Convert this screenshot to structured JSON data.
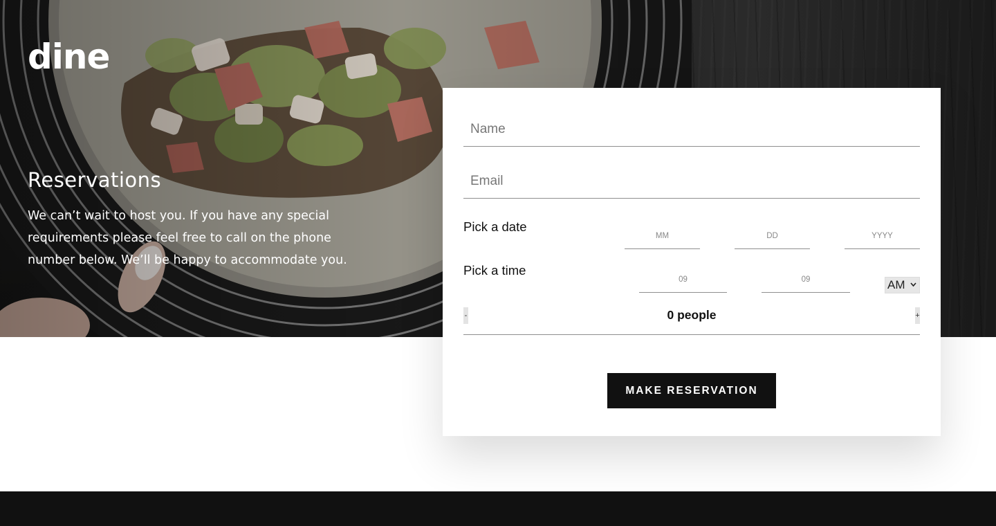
{
  "brand": {
    "logo_text": "dine"
  },
  "hero": {
    "title": "Reservations",
    "text": "We can’t wait to host you. If you have any special requirements please feel free to call on the phone number below. We’ll be happy to accommodate you."
  },
  "form": {
    "name_placeholder": "Name",
    "email_placeholder": "Email",
    "date": {
      "label": "Pick a date",
      "month_placeholder": "MM",
      "day_placeholder": "DD",
      "year_placeholder": "YYYY"
    },
    "time": {
      "label": "Pick a time",
      "hour_placeholder": "09",
      "minute_placeholder": "09",
      "period_value": "AM"
    },
    "people": {
      "decrement_label": "-",
      "increment_label": "+",
      "count_text": "0 people"
    },
    "submit_label": "MAKE RESERVATION"
  },
  "colors": {
    "primary": "#111111",
    "background": "#ffffff",
    "hero_text": "#ffffff"
  },
  "icons": {
    "period_select": "chevron-down-icon"
  }
}
